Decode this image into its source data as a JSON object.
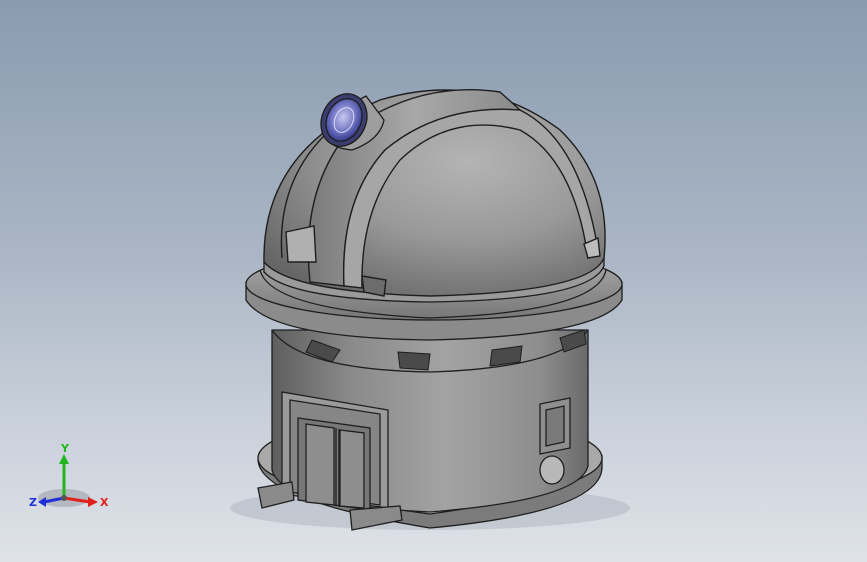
{
  "viewport": {
    "model_name": "observatory-dome"
  },
  "triad": {
    "x_label": "X",
    "y_label": "Y",
    "z_label": "Z",
    "x_color": "#e0201a",
    "y_color": "#22b522",
    "z_color": "#2030d8"
  },
  "colors": {
    "background_top": "#8a9bb0",
    "background_bottom": "#dfe3e8",
    "model_body": "#8c8c8c",
    "lens": "#5a5fb0"
  }
}
